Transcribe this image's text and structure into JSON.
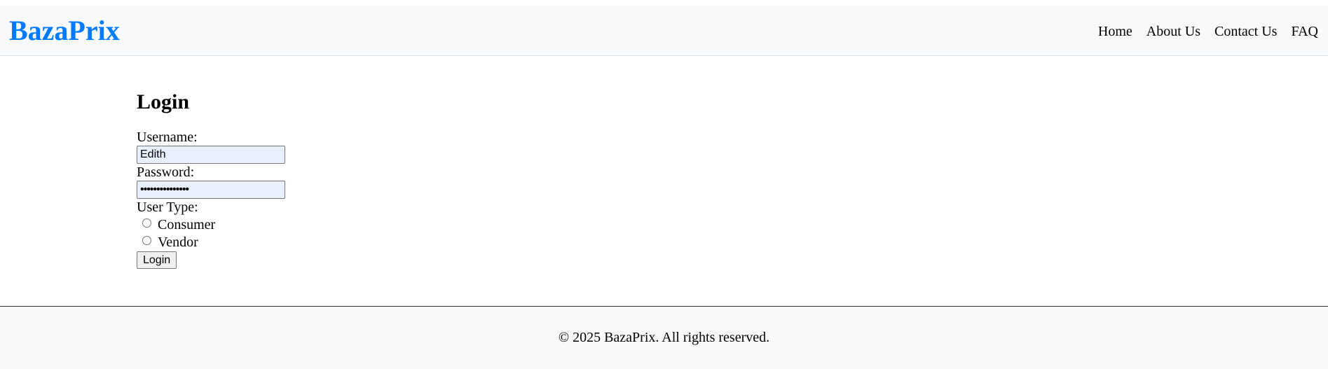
{
  "header": {
    "brand": "BazaPrix",
    "nav": [
      "Home",
      "About Us",
      "Contact Us",
      "FAQ"
    ]
  },
  "login": {
    "title": "Login",
    "username_label": "Username:",
    "username_value": "Edith",
    "password_label": "Password:",
    "password_value": "•••••••••••••••",
    "user_type_label": "User Type:",
    "user_types": [
      "Consumer",
      "Vendor"
    ],
    "submit_label": "Login"
  },
  "footer": {
    "text": "© 2025 BazaPrix. All rights reserved."
  },
  "colors": {
    "brand": "#007bff",
    "header_bg": "#f8f9fa",
    "autofill_bg": "#e8f0fe"
  }
}
